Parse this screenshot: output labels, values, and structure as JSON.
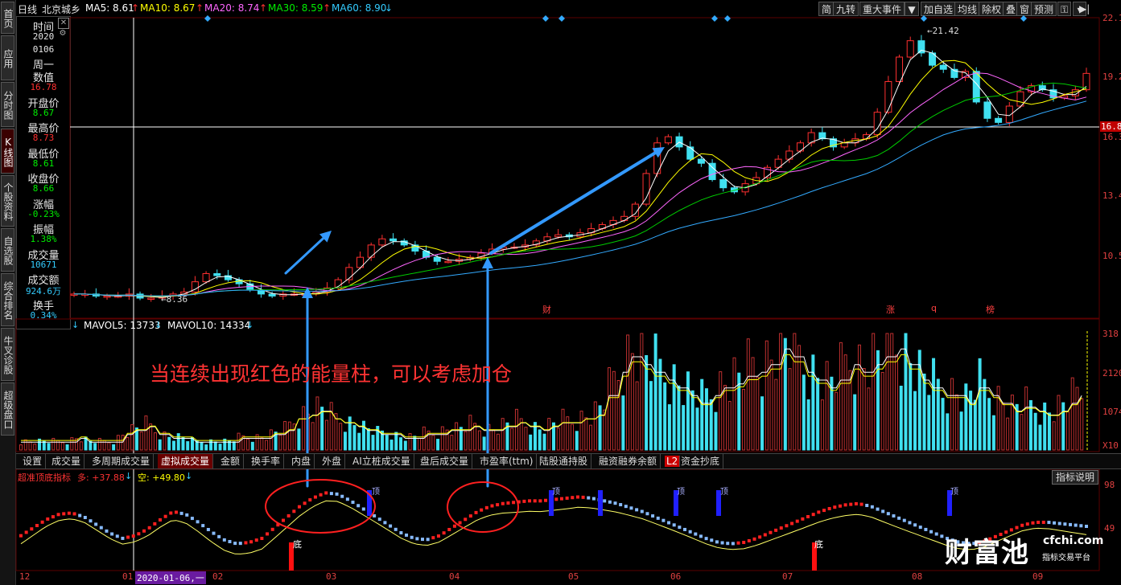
{
  "title": "日线",
  "stock_name": "北京城乡",
  "ma": {
    "ma5": "MA5: 8.61",
    "ma10": "MA10: 8.67",
    "ma20": "MA20: 8.74",
    "ma30": "MA30: 8.59",
    "ma60": "MA60: 8.90"
  },
  "colors": {
    "up": "#ff3030",
    "down": "#40e0f0",
    "ma5": "#ffffff",
    "ma10": "#ffff00",
    "ma20": "#ff66ff",
    "ma30": "#00cc00",
    "ma60": "#33aaff",
    "axis": "#e04040",
    "annotation": "#ff3333",
    "arrow": "#3399ff"
  },
  "toolbar": [
    "简",
    "九转",
    "重大事件",
    "加自选",
    "均线",
    "除权",
    "叠",
    "窗",
    "预测"
  ],
  "toolbar_dropdown": "▼",
  "left_nav": [
    "首页",
    "应用",
    "分时图",
    "K线图",
    "个股资料",
    "自选股",
    "综合排名",
    "牛叉诊股",
    "超级盘口"
  ],
  "info": [
    {
      "label": "时间",
      "value": ""
    },
    {
      "label": "",
      "value": "2020"
    },
    {
      "label": "",
      "value": "0106"
    },
    {
      "label": "周一",
      "value": ""
    },
    {
      "label": "数值",
      "value": ""
    },
    {
      "label": "",
      "value": "16.78"
    },
    {
      "label": "开盘价",
      "value": ""
    },
    {
      "label": "",
      "value": "8.67"
    },
    {
      "label": "最高价",
      "value": ""
    },
    {
      "label": "",
      "value": "8.73"
    },
    {
      "label": "最低价",
      "value": ""
    },
    {
      "label": "",
      "value": "8.61"
    },
    {
      "label": "收盘价",
      "value": ""
    },
    {
      "label": "",
      "value": "8.66"
    },
    {
      "label": "涨幅",
      "value": ""
    },
    {
      "label": "",
      "value": "-0.23%"
    },
    {
      "label": "振幅",
      "value": ""
    },
    {
      "label": "",
      "value": "1.38%"
    },
    {
      "label": "成交量",
      "value": ""
    },
    {
      "label": "",
      "value": "10671"
    },
    {
      "label": "成交额",
      "value": ""
    },
    {
      "label": "",
      "value": "924.6万"
    },
    {
      "label": "换手",
      "value": ""
    },
    {
      "label": "",
      "value": "0.34%"
    }
  ],
  "price_axis": [
    "22.1",
    "19.2",
    "16.8",
    "16.3",
    "13.4",
    "10.5"
  ],
  "crosshair_price": "16.8",
  "chart_labels": {
    "high": "21.42",
    "low": "8.36",
    "markers": [
      "财",
      "涨",
      "q",
      "榜"
    ]
  },
  "volume": {
    "mavol5": "MAVOL5: 13733",
    "mavol10": "MAVOL10: 14334",
    "axis": [
      "318",
      "2120",
      "1074",
      "X10"
    ]
  },
  "annotation_text": "当连续出现红色的能量柱，可以考虑加仓",
  "tabs": [
    "设置",
    "成交量",
    "多周期成交量",
    "虚拟成交量",
    "金额",
    "换手率",
    "内盘",
    "外盘",
    "AI立桩成交量",
    "盘后成交量",
    "市盈率(ttm)",
    "陆股通持股",
    "融资融券余额",
    "L2",
    "资金抄底"
  ],
  "active_tab": "虚拟成交量",
  "indicator": {
    "name": "超准顶底指标",
    "duo": "多: +37.88",
    "kong": "空: +49.80",
    "help_button": "指标说明",
    "axis": [
      "98",
      "49"
    ],
    "top_label": "顶",
    "bottom_label": "底"
  },
  "bottom_axis": [
    "12",
    "01",
    "2020-01-06,一",
    "02",
    "03",
    "04",
    "05",
    "06",
    "07",
    "08",
    "09"
  ],
  "watermark": {
    "brand": "财富池",
    "site": "cfchi.com",
    "sub": "指标交易平台"
  },
  "chart_data": {
    "type": "candlestick",
    "price_range": [
      8.36,
      21.42
    ],
    "x_months": [
      "12",
      "01",
      "02",
      "03",
      "04",
      "05",
      "06",
      "07",
      "08",
      "09"
    ],
    "price_path": [
      8.6,
      8.6,
      8.5,
      8.5,
      8.5,
      8.6,
      8.4,
      8.4,
      8.5,
      8.6,
      8.7,
      9.2,
      9.6,
      9.5,
      9.3,
      9.1,
      8.8,
      8.6,
      8.5,
      8.6,
      8.6,
      8.6,
      8.7,
      8.9,
      9.3,
      9.9,
      10.4,
      11.0,
      11.3,
      11.2,
      11.0,
      10.7,
      10.4,
      10.2,
      10.2,
      10.3,
      10.4,
      10.6,
      10.8,
      10.9,
      10.9,
      11.0,
      11.2,
      11.4,
      11.5,
      11.4,
      11.6,
      11.8,
      12.0,
      12.2,
      12.4,
      13.0,
      14.5,
      16.0,
      16.3,
      15.8,
      15.2,
      15.0,
      14.2,
      13.8,
      13.6,
      14.0,
      14.3,
      14.8,
      15.2,
      15.6,
      16.0,
      16.5,
      16.2,
      15.8,
      16.0,
      16.2,
      16.4,
      17.5,
      19.0,
      20.2,
      21.0,
      20.4,
      19.8,
      19.6,
      19.2,
      19.5,
      18.0,
      17.2,
      17.0,
      17.8,
      18.5,
      18.8,
      18.6,
      18.2,
      18.3,
      18.6,
      19.4
    ],
    "volume_path": [
      2,
      2,
      2,
      2,
      2,
      3,
      2,
      2,
      2,
      4,
      5,
      6,
      4,
      3,
      3,
      2,
      2,
      2,
      2,
      3,
      3,
      3,
      4,
      5,
      8,
      9,
      10,
      8,
      7,
      6,
      5,
      4,
      4,
      3,
      3,
      4,
      4,
      5,
      5,
      6,
      5,
      5,
      6,
      7,
      6,
      5,
      6,
      7,
      7,
      8,
      9,
      14,
      20,
      24,
      22,
      20,
      18,
      16,
      14,
      12,
      14,
      16,
      17,
      19,
      20,
      22,
      26,
      24,
      20,
      18,
      16,
      18,
      22,
      20,
      22,
      24,
      26,
      22,
      18,
      16,
      14,
      14,
      12,
      16,
      14,
      12,
      10,
      11,
      10,
      9,
      10,
      12,
      14
    ],
    "indicator_path": [
      60,
      66,
      72,
      76,
      77,
      74,
      68,
      62,
      58,
      60,
      65,
      72,
      78,
      76,
      70,
      63,
      57,
      54,
      55,
      58,
      66,
      74,
      82,
      88,
      92,
      91,
      86,
      80,
      74,
      68,
      62,
      58,
      57,
      60,
      66,
      72,
      78,
      82,
      84,
      85,
      86,
      86,
      87,
      88,
      89,
      88,
      86,
      84,
      81,
      78,
      74,
      70,
      66,
      62,
      58,
      55,
      54,
      55,
      58,
      62,
      66,
      70,
      74,
      78,
      81,
      83,
      84,
      82,
      78,
      74,
      70,
      66,
      62,
      58,
      55,
      54,
      56,
      60,
      64,
      68,
      70,
      70,
      69,
      68,
      67
    ]
  }
}
